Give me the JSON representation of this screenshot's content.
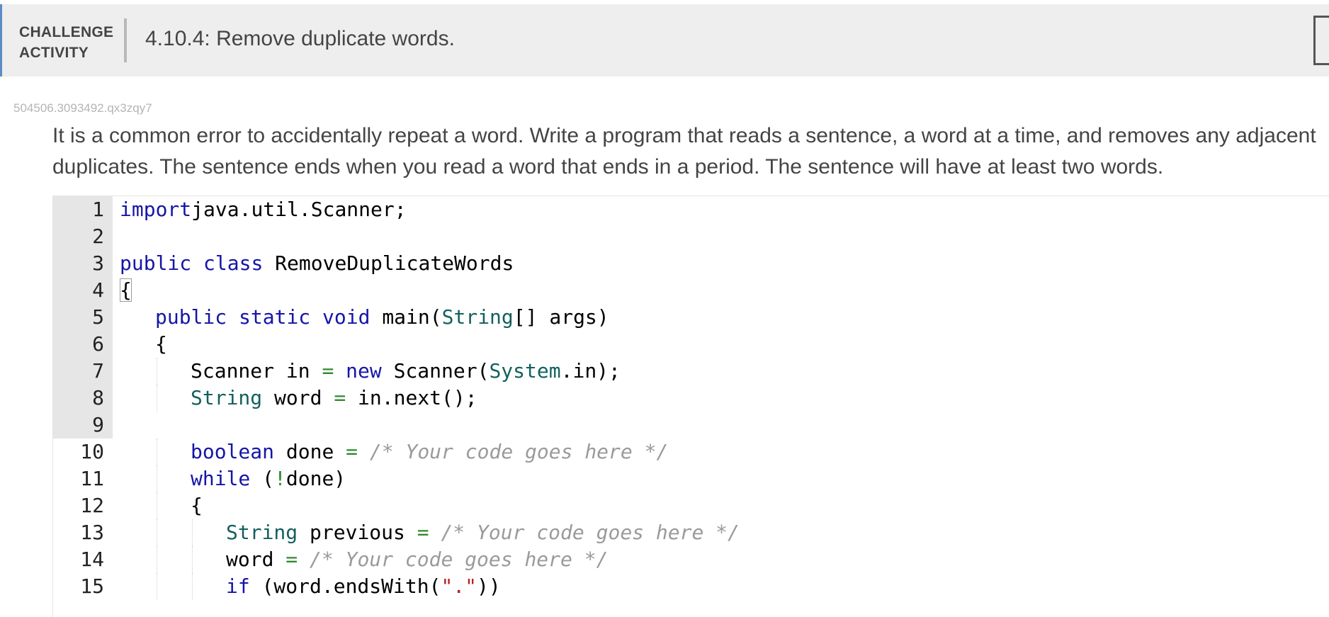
{
  "header": {
    "badge_line1": "CHALLENGE",
    "badge_line2": "ACTIVITY",
    "title": "4.10.4: Remove duplicate words."
  },
  "activity_id": "504506.3093492.qx3zqy7",
  "instructions": "It is a common error to accidentally repeat a word. Write a program that reads a sentence, a word at a time, and removes any adjacent duplicates. The sentence ends when you read a word that ends in a period. The sentence will have at least two words.",
  "editor": {
    "readonly_until_line": 9,
    "lines": [
      {
        "n": "1",
        "indent": 0,
        "tokens": [
          [
            "kw",
            "import"
          ],
          [
            "",
            "java.util.Scanner;"
          ]
        ]
      },
      {
        "n": "2",
        "indent": 0,
        "tokens": []
      },
      {
        "n": "3",
        "indent": 0,
        "tokens": [
          [
            "kw",
            "public"
          ],
          [
            "",
            " "
          ],
          [
            "kw",
            "class"
          ],
          [
            "",
            " RemoveDuplicateWords"
          ]
        ]
      },
      {
        "n": "4",
        "indent": 0,
        "tokens": [
          [
            "brace",
            "{"
          ]
        ]
      },
      {
        "n": "5",
        "indent": 1,
        "tokens": [
          [
            "kw",
            "public"
          ],
          [
            "",
            " "
          ],
          [
            "kw",
            "static"
          ],
          [
            "",
            " "
          ],
          [
            "kw",
            "void"
          ],
          [
            "",
            " main("
          ],
          [
            "ty",
            "String"
          ],
          [
            "",
            "[] args)"
          ]
        ]
      },
      {
        "n": "6",
        "indent": 1,
        "tokens": [
          [
            "",
            "{"
          ]
        ]
      },
      {
        "n": "7",
        "indent": 2,
        "tokens": [
          [
            "",
            "Scanner in "
          ],
          [
            "op",
            "="
          ],
          [
            "",
            " "
          ],
          [
            "kw",
            "new"
          ],
          [
            "",
            " Scanner("
          ],
          [
            "ty",
            "System"
          ],
          [
            "",
            ".in);"
          ]
        ]
      },
      {
        "n": "8",
        "indent": 2,
        "tokens": [
          [
            "ty",
            "String"
          ],
          [
            "",
            " word "
          ],
          [
            "op",
            "="
          ],
          [
            "",
            " in.next();"
          ]
        ]
      },
      {
        "n": "9",
        "indent": 0,
        "tokens": []
      },
      {
        "n": "10",
        "indent": 2,
        "tokens": [
          [
            "kw",
            "boolean"
          ],
          [
            "",
            " done "
          ],
          [
            "op",
            "="
          ],
          [
            "",
            " "
          ],
          [
            "cm",
            "/* Your code goes here */"
          ]
        ]
      },
      {
        "n": "11",
        "indent": 2,
        "tokens": [
          [
            "kw",
            "while"
          ],
          [
            "",
            " ("
          ],
          [
            "op",
            "!"
          ],
          [
            "",
            "done)"
          ]
        ]
      },
      {
        "n": "12",
        "indent": 2,
        "tokens": [
          [
            "",
            "{"
          ]
        ]
      },
      {
        "n": "13",
        "indent": 3,
        "tokens": [
          [
            "ty",
            "String"
          ],
          [
            "",
            " previous "
          ],
          [
            "op",
            "="
          ],
          [
            "",
            " "
          ],
          [
            "cm",
            "/* Your code goes here */"
          ]
        ]
      },
      {
        "n": "14",
        "indent": 3,
        "tokens": [
          [
            "",
            "word "
          ],
          [
            "op",
            "="
          ],
          [
            "",
            " "
          ],
          [
            "cm",
            "/* Your code goes here */"
          ]
        ]
      },
      {
        "n": "15",
        "indent": 3,
        "tokens": [
          [
            "kw",
            "if"
          ],
          [
            "",
            " (word.endsWith("
          ],
          [
            "st",
            "\".\""
          ],
          [
            "",
            "))"
          ]
        ]
      }
    ]
  }
}
